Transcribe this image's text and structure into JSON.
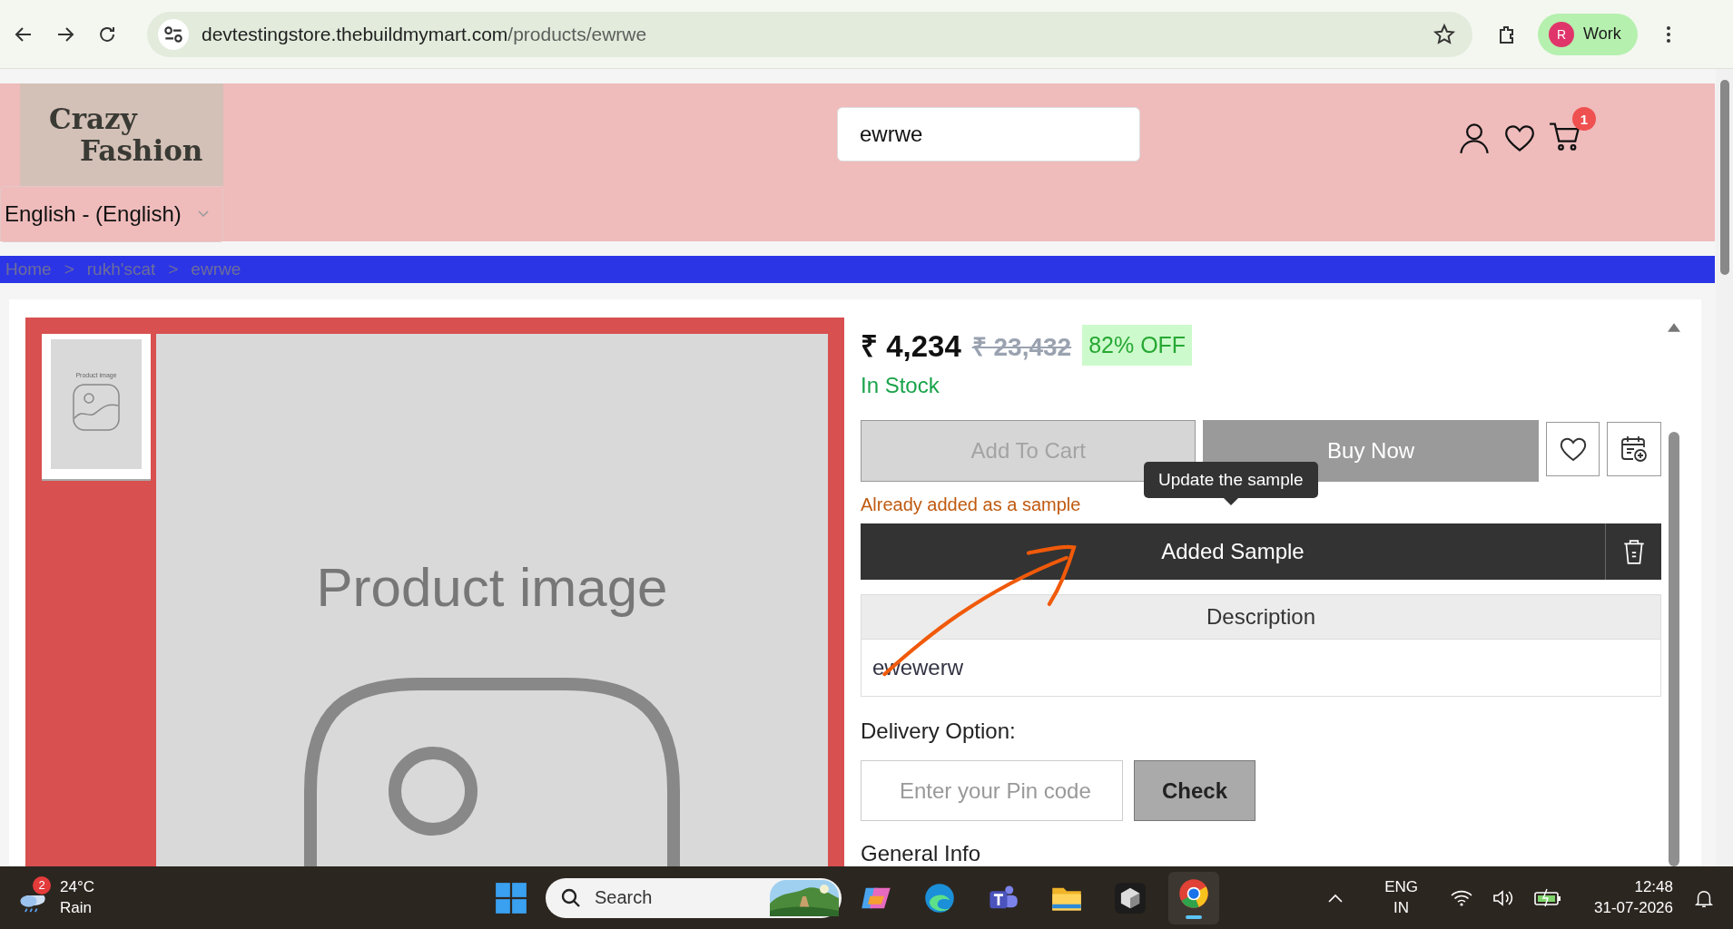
{
  "browser": {
    "url_host": "devtestingstore.thebuildmymart.com",
    "url_path": "/products/ewrwe",
    "profile": {
      "initial": "R",
      "name": "Work"
    }
  },
  "header": {
    "logo_lines": [
      "Crazy",
      "Fashion"
    ],
    "search_value": "ewrwe",
    "cart_count": "1",
    "language": "English - (English)"
  },
  "breadcrumb": {
    "links": [
      "Home",
      "rukh'scat",
      "ewrwe"
    ],
    "separators": [
      ">",
      ">"
    ]
  },
  "gallery": {
    "thumbnail_caption": "Product image",
    "main_caption": "Product image"
  },
  "product": {
    "price": "₹ 4,234",
    "mrp": "₹ 23,432",
    "discount": "82% OFF",
    "stock": "In Stock",
    "add_to_cart": {
      "label": "Add To Cart",
      "disabled": true
    },
    "buy_now": "Buy Now",
    "tooltip": "Update the sample",
    "sample_note": "Already added as a sample",
    "added_sample": "Added Sample",
    "description": {
      "title": "Description",
      "body": "ewewerw"
    },
    "delivery_label": "Delivery Option:",
    "pin_placeholder": "Enter your Pin code",
    "check": "Check",
    "general_info": "General Info"
  },
  "taskbar": {
    "weather": {
      "badge": "2",
      "temperature": "24°C",
      "condition": "Rain"
    },
    "search_placeholder": "Search",
    "language": [
      "ENG",
      "IN"
    ],
    "time": "12:48",
    "date": "31-07-2026"
  }
}
